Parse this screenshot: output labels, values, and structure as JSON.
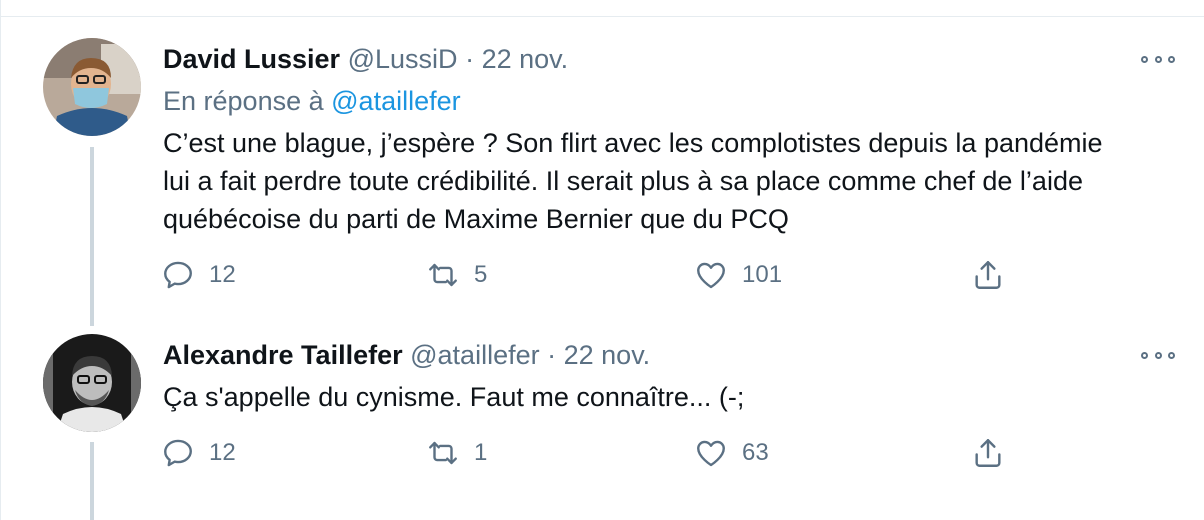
{
  "tweets": [
    {
      "display_name": "David Lussier",
      "handle": "@LussiD",
      "separator": "·",
      "date": "22 nov.",
      "reply_prefix": "En réponse à",
      "reply_mention": "@ataillefer",
      "text": "C’est une blague, j’espère ?  Son flirt avec les complotistes depuis la pandémie lui a fait perdre toute crédibilité. Il serait plus à sa place comme chef de l’aide québécoise du parti de Maxime Bernier que du PCQ",
      "replies": "12",
      "retweets": "5",
      "likes": "101"
    },
    {
      "display_name": "Alexandre Taillefer",
      "handle": "@ataillefer",
      "separator": "·",
      "date": "22 nov.",
      "text": "Ça s'appelle du cynisme.  Faut me connaître... (-;",
      "replies": "12",
      "retweets": "1",
      "likes": "63"
    }
  ],
  "icons": {
    "reply": "reply-icon",
    "retweet": "retweet-icon",
    "like": "heart-icon",
    "share": "share-icon",
    "more": "more-icon"
  },
  "colors": {
    "text": "#0f1419",
    "secondary": "#5b7083",
    "link": "#1b95e0",
    "thread_line": "#ccd6dd"
  }
}
